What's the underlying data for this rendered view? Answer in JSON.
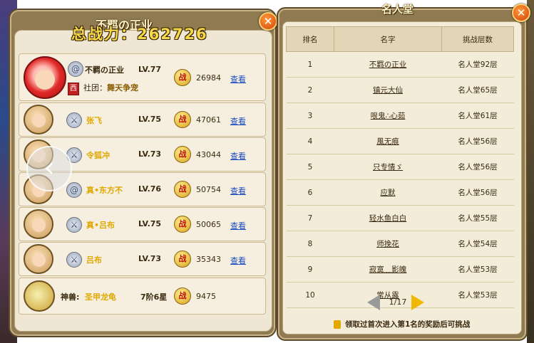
{
  "left_panel": {
    "title": "不羁の正业",
    "total_power_label": "总战力：",
    "total_power_value": "262726",
    "close_icon": "close-icon",
    "leader": {
      "name": "不羁の正业",
      "level": "LV.77",
      "power": "26984",
      "view": "查看",
      "guild_label": "社团：",
      "guild_name": "舞天争宠",
      "faction_badge": "西"
    },
    "members": [
      {
        "name": "张飞",
        "level": "LV.75",
        "power": "47061",
        "view": "查看",
        "icon": "sword-icon"
      },
      {
        "name": "令狐冲",
        "level": "LV.73",
        "power": "43044",
        "view": "查看",
        "icon": "sword-icon"
      },
      {
        "name": "真•东方不",
        "level": "LV.76",
        "power": "50754",
        "view": "查看",
        "icon": "swirl-icon"
      },
      {
        "name": "真•吕布",
        "level": "LV.75",
        "power": "50065",
        "view": "查看",
        "icon": "sword-icon"
      },
      {
        "name": "吕布",
        "level": "LV.73",
        "power": "35343",
        "view": "查看",
        "icon": "sword-icon"
      }
    ],
    "beast": {
      "label": "神兽:",
      "name": "圣甲龙龟",
      "level": "7阶6星",
      "power": "9475"
    },
    "zhan_glyph": "战"
  },
  "right_panel": {
    "title": "名人堂",
    "close_icon": "close-icon",
    "headers": [
      "排名",
      "名字",
      "挑战层数"
    ],
    "rows": [
      {
        "rank": "1",
        "name": "不羁の正业",
        "floor": "名人堂92层"
      },
      {
        "rank": "2",
        "name": "镇元大仙",
        "floor": "名人堂65层"
      },
      {
        "rank": "3",
        "name": "哏鬼∴心茹",
        "floor": "名人堂61层"
      },
      {
        "rank": "4",
        "name": "風无痕",
        "floor": "名人堂56层"
      },
      {
        "rank": "5",
        "name": "只专情ゞ",
        "floor": "名人堂56层"
      },
      {
        "rank": "6",
        "name": "应默",
        "floor": "名人堂56层"
      },
      {
        "rank": "7",
        "name": "轻水鱼白白",
        "floor": "名人堂55层"
      },
      {
        "rank": "8",
        "name": "师挽花",
        "floor": "名人堂54层"
      },
      {
        "rank": "9",
        "name": "寂寞﹏影魄",
        "floor": "名人堂53层"
      },
      {
        "rank": "10",
        "name": "常从露",
        "floor": "名人堂53层"
      }
    ],
    "pager": "1/17",
    "hint": "领取过首次进入第1名的奖励后可挑战"
  },
  "nav": {
    "left_arrow": "‹",
    "right_arrow": "›"
  },
  "colors": {
    "gold": "#f6d84b",
    "name_yellow": "#e0a800",
    "link_blue": "#1a4cc0",
    "panel_brown": "#8f7a52"
  }
}
